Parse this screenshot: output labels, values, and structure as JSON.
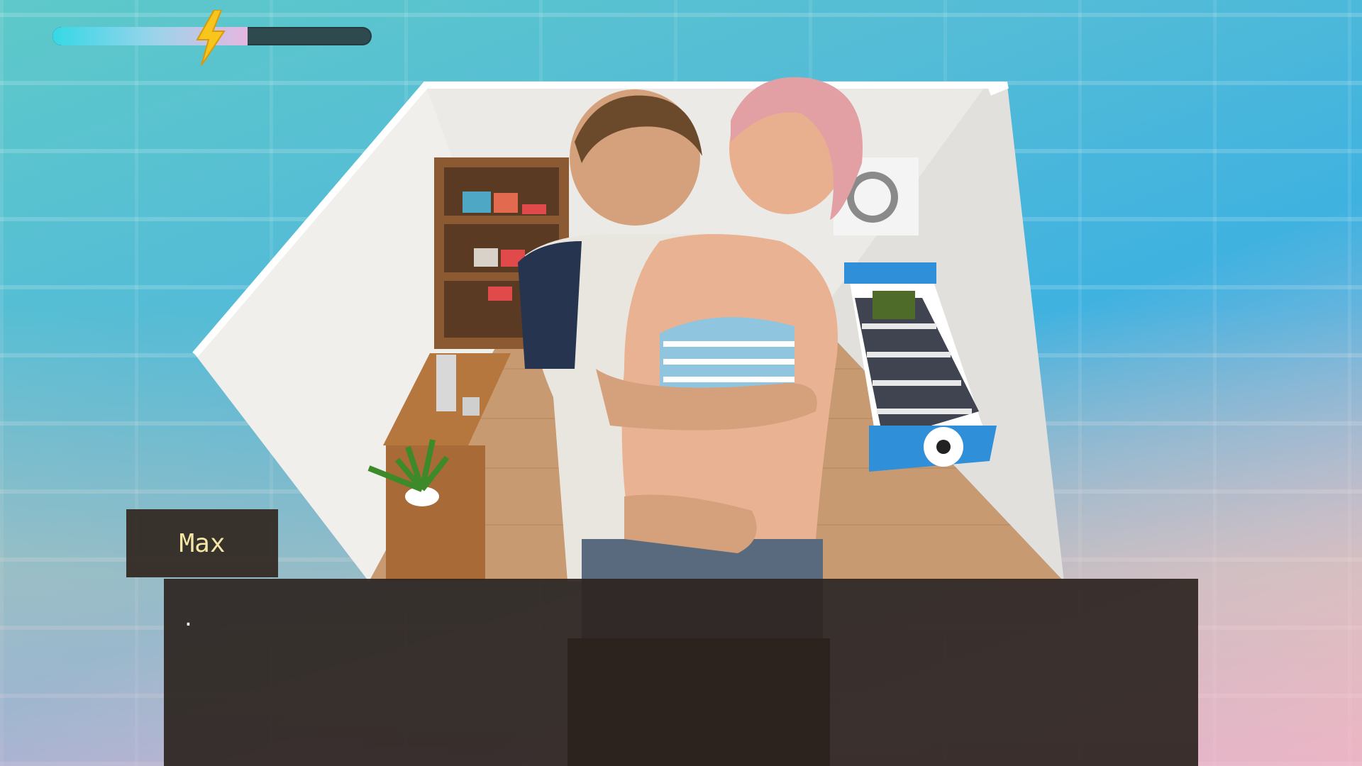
{
  "hud": {
    "energy_level": 0.61,
    "energy_icon": "lightning-bolt-icon",
    "colors": {
      "fill_start": "#35d8e6",
      "fill_end": "#e6b6df",
      "track": "#2f4a4f",
      "bolt": "#f7c51c"
    }
  },
  "dialogue": {
    "speaker": "Max",
    "text": "."
  }
}
